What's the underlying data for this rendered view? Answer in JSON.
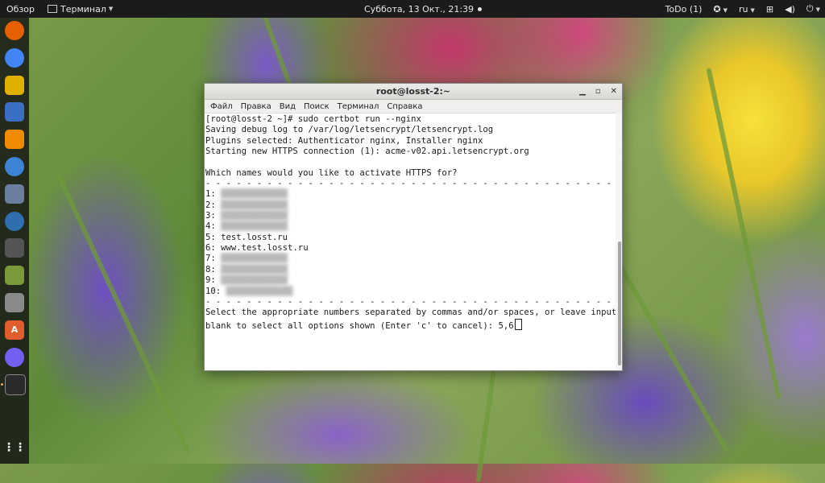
{
  "topbar": {
    "overview": "Обзор",
    "app_menu": "Терминал",
    "clock": "Суббота, 13 Окт., 21:39",
    "todo": "ToDo (1)",
    "language": "ru"
  },
  "dock": {
    "apps": [
      {
        "name": "firefox",
        "color": "#e66000",
        "glyph": ""
      },
      {
        "name": "chrome",
        "color": "#4285f4",
        "glyph": ""
      },
      {
        "name": "rhythmbox",
        "color": "#e0b000",
        "glyph": ""
      },
      {
        "name": "files-manager",
        "color": "#3a6fc4",
        "glyph": ""
      },
      {
        "name": "vlc",
        "color": "#f08a00",
        "glyph": ""
      },
      {
        "name": "simplenote",
        "color": "#3d84d6",
        "glyph": ""
      },
      {
        "name": "settings-tools",
        "color": "#6b7ea0",
        "glyph": ""
      },
      {
        "name": "thunderbird",
        "color": "#2f6fb0",
        "glyph": ""
      },
      {
        "name": "calculator",
        "color": "#555555",
        "glyph": ""
      },
      {
        "name": "image-viewer",
        "color": "#7a9a3a",
        "glyph": ""
      },
      {
        "name": "installer",
        "color": "#8a8a8a",
        "glyph": ""
      },
      {
        "name": "software-center",
        "color": "#e25d2d",
        "glyph": "A"
      },
      {
        "name": "viber",
        "color": "#7360f2",
        "glyph": ""
      },
      {
        "name": "terminal",
        "color": "#2b2b2b",
        "glyph": ""
      }
    ],
    "apps_grid": "⋮⋮"
  },
  "window": {
    "title": "root@losst-2:~",
    "menu": [
      "Файл",
      "Правка",
      "Вид",
      "Поиск",
      "Терминал",
      "Справка"
    ]
  },
  "terminal": {
    "lines": [
      "[root@losst-2 ~]# sudo certbot run --nginx",
      "Saving debug log to /var/log/letsencrypt/letsencrypt.log",
      "Plugins selected: Authenticator nginx, Installer nginx",
      "Starting new HTTPS connection (1): acme-v02.api.letsencrypt.org",
      "",
      "Which names would you like to activate HTTPS for?",
      "- - - - - - - - - - - - - - - - - - - - - - - - - - - - - - - - - - - - - - - -"
    ],
    "options": [
      {
        "num": "1: ",
        "text": "",
        "blurred": true
      },
      {
        "num": "2: ",
        "text": "",
        "blurred": true
      },
      {
        "num": "3: ",
        "text": "",
        "blurred": true
      },
      {
        "num": "4: ",
        "text": "",
        "blurred": true
      },
      {
        "num": "5: ",
        "text": "test.losst.ru",
        "blurred": false
      },
      {
        "num": "6: ",
        "text": "www.test.losst.ru",
        "blurred": false
      },
      {
        "num": "7: ",
        "text": "",
        "blurred": true
      },
      {
        "num": "8: ",
        "text": "",
        "blurred": true
      },
      {
        "num": "9: ",
        "text": "",
        "blurred": true
      },
      {
        "num": "10: ",
        "text": "",
        "blurred": true
      }
    ],
    "tail": [
      "- - - - - - - - - - - - - - - - - - - - - - - - - - - - - - - - - - - - - - - -",
      "Select the appropriate numbers separated by commas and/or spaces, or leave input"
    ],
    "prompt": "blank to select all options shown (Enter 'c' to cancel): ",
    "input_value": "5,6"
  }
}
